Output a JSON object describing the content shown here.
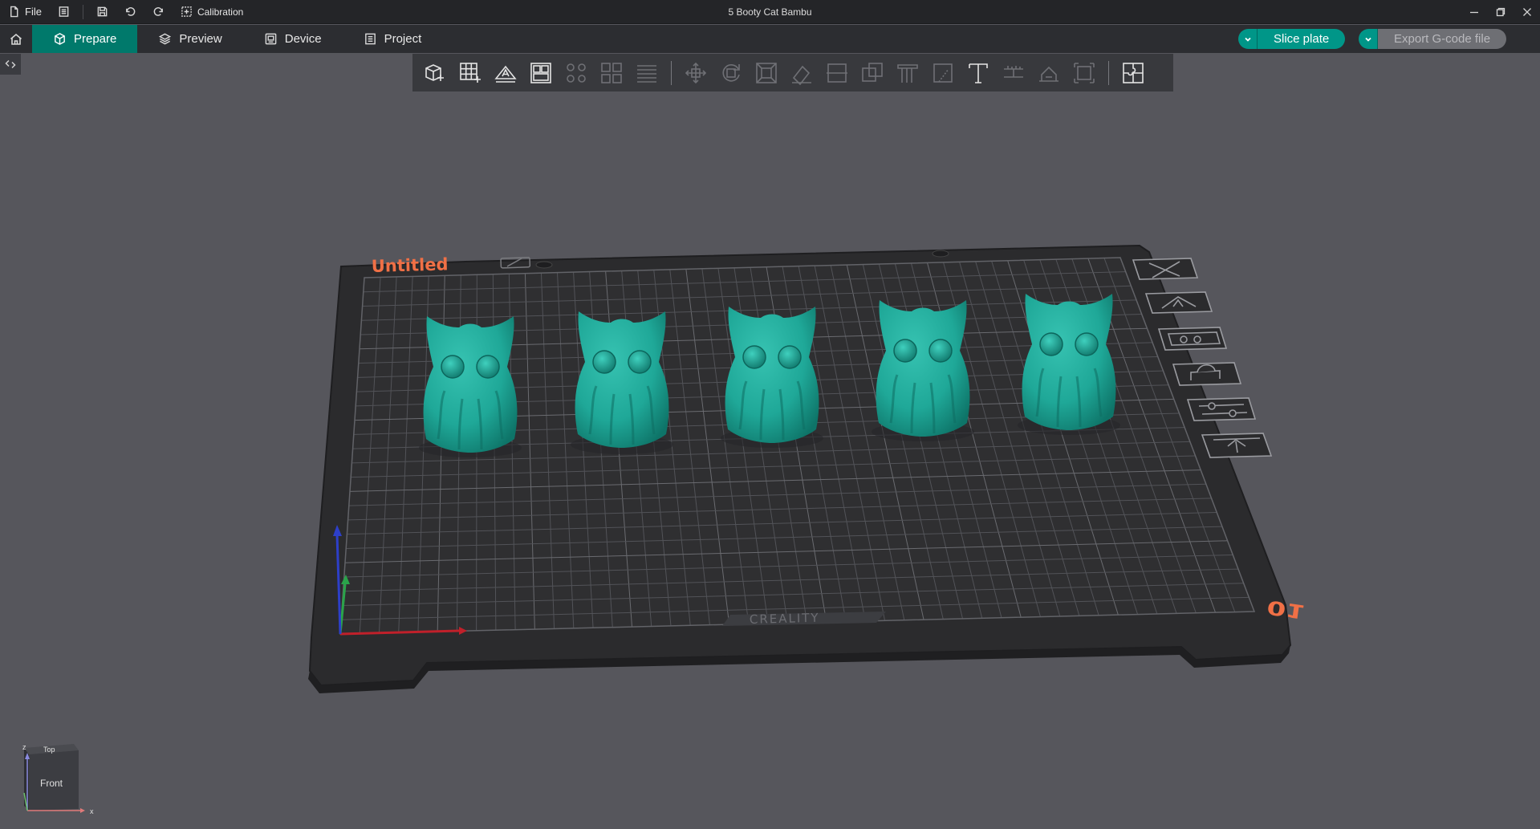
{
  "titlebar": {
    "file_label": "File",
    "calibration_label": "Calibration",
    "title": "5 Booty Cat Bambu"
  },
  "tabs": [
    {
      "label": "Prepare",
      "icon": "cube-icon",
      "active": true
    },
    {
      "label": "Preview",
      "icon": "layers-icon",
      "active": false
    },
    {
      "label": "Device",
      "icon": "device-icon",
      "active": false
    },
    {
      "label": "Project",
      "icon": "project-icon",
      "active": false
    }
  ],
  "actions": {
    "slice_label": "Slice plate",
    "export_label": "Export G-code file"
  },
  "plate": {
    "name": "Untitled",
    "number": "01",
    "brand": "CREALITY",
    "object_count": 5
  },
  "viewcube": {
    "top_label": "Top",
    "front_label": "Front",
    "axis_x": "x",
    "axis_z": "z"
  },
  "colors": {
    "accent": "#009688",
    "active_tab": "#00796b",
    "model": "#1fa898",
    "plate_label": "#f07046",
    "background": "#56565c"
  }
}
